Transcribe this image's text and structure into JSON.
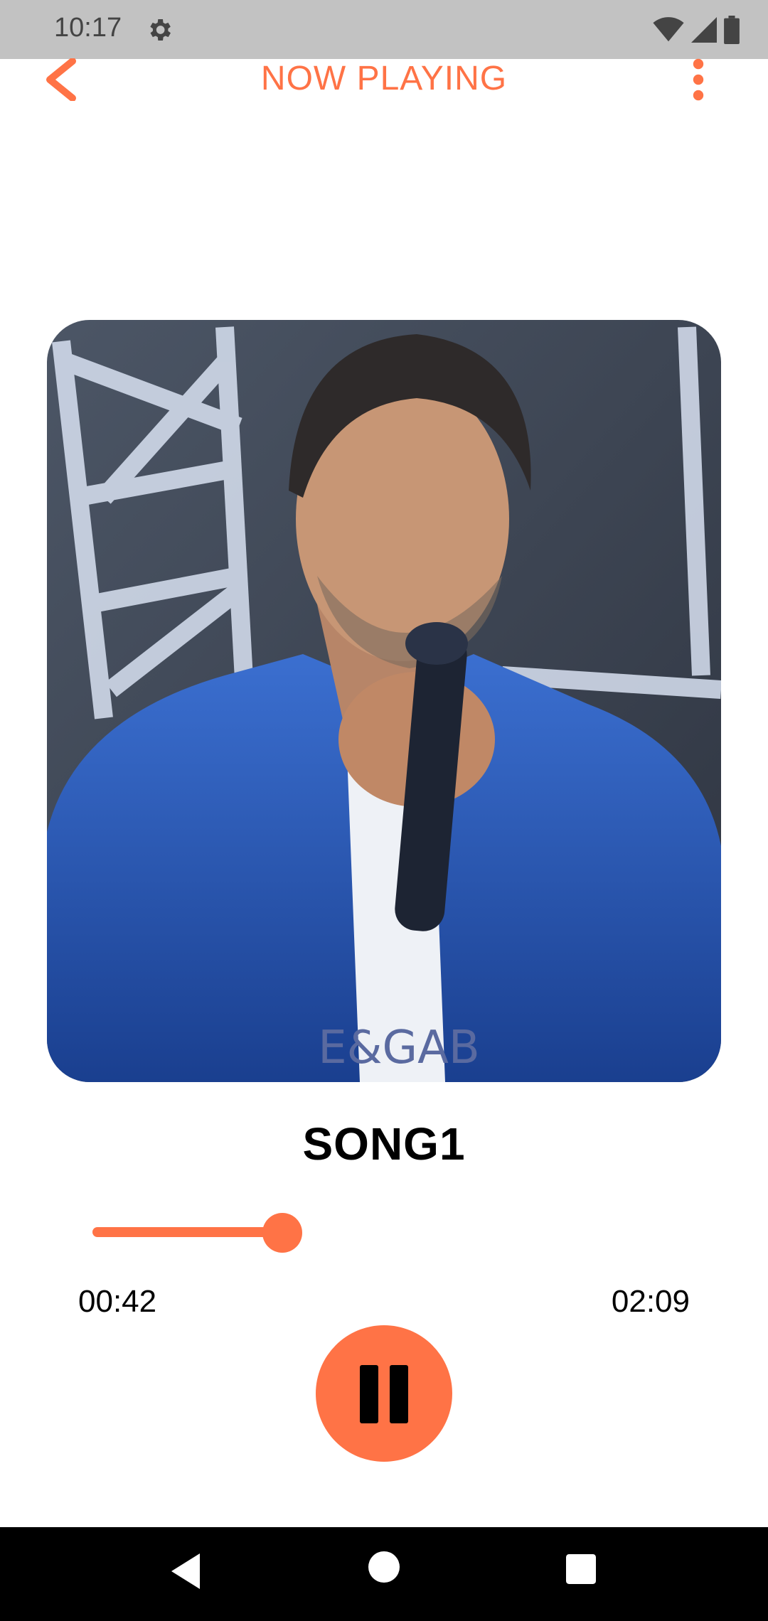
{
  "status_bar": {
    "time": "10:17",
    "icons": [
      "gear-icon",
      "wifi-icon",
      "signal-icon",
      "battery-icon"
    ]
  },
  "header": {
    "title": "NOW PLAYING",
    "back_icon": "chevron-left-icon",
    "menu_icon": "more-vert-icon"
  },
  "colors": {
    "accent": "#ff7346",
    "status_bar": "#c2c2c2",
    "nav_bar": "#000000"
  },
  "player": {
    "song_title": "SONG1",
    "current_time": "00:42",
    "total_time": "02:09",
    "progress": 0.325,
    "artwork_text": "E&GAB",
    "play_state_icon": "pause-icon"
  },
  "nav_bar": {
    "icons": [
      "back-icon",
      "home-icon",
      "recents-icon"
    ]
  }
}
